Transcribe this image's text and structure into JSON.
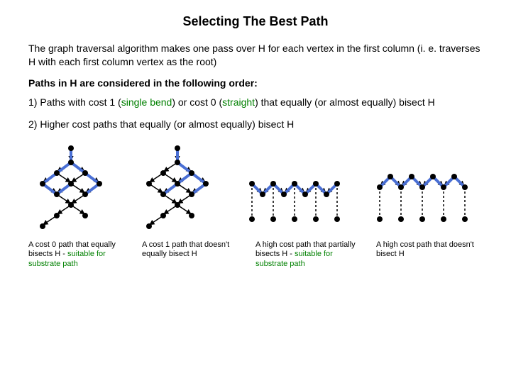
{
  "title": "Selecting The Best Path",
  "intro": "The graph traversal algorithm makes one pass over H for each vertex in the first column (i. e. traverses H with each first column vertex as the root)",
  "subhead": "Paths in H are considered in the following order:",
  "rule1_a": "1) Paths with cost 1 (",
  "rule1_b": "single bend",
  "rule1_c": ") or cost 0 (",
  "rule1_d": "straight",
  "rule1_e": ") that equally (or almost equally) bisect H",
  "rule2": "2) Higher cost paths that equally (or almost equally) bisect H",
  "cap1_a": "A cost 0 path that equally bisects H - ",
  "cap1_b": "suitable for substrate path",
  "cap2": "A cost 1 path that doesn't equally bisect H",
  "cap3_a": "A high cost path that partially bisects H - ",
  "cap3_b": "suitable for substrate path",
  "cap4": "A high cost path that doesn't bisect H"
}
